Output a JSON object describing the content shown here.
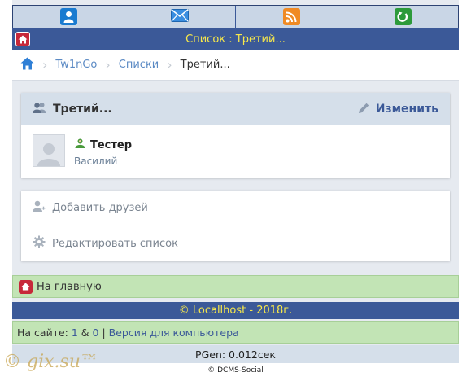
{
  "nav": {
    "items": [
      {
        "icon": "user-icon",
        "color": "#1a7bd0"
      },
      {
        "icon": "mail-icon",
        "color": "#2e86d6"
      },
      {
        "icon": "rss-icon",
        "color": "#f08a24"
      },
      {
        "icon": "refresh-icon",
        "color": "#2c9a3a"
      }
    ]
  },
  "title": "Список : Третий...",
  "breadcrumb": {
    "items": [
      "Tw1nGo",
      "Списки"
    ],
    "current": "Третий..."
  },
  "list": {
    "name": "Третий...",
    "edit_label": "Изменить",
    "member": {
      "username": "Тестер",
      "realname": "Василий"
    }
  },
  "actions": {
    "add_friends": "Добавить друзей",
    "edit_list": "Редактировать список"
  },
  "footer": {
    "home_label": "На главную",
    "copyright": "© Locallhost - 2018г.",
    "online_prefix": "На сайте: ",
    "online_users": "1",
    "online_amp": " & ",
    "online_guests": "0",
    "online_sep": " | ",
    "desktop_link": "Версия для компьютера",
    "pgen": "PGen: 0.012сек",
    "engine": "© DCMS-Social"
  },
  "watermark": "© gix.su™",
  "colors": {
    "brand": "#3b5998",
    "title_text": "#f7e84a",
    "green_bar": "#c2e4b5"
  }
}
